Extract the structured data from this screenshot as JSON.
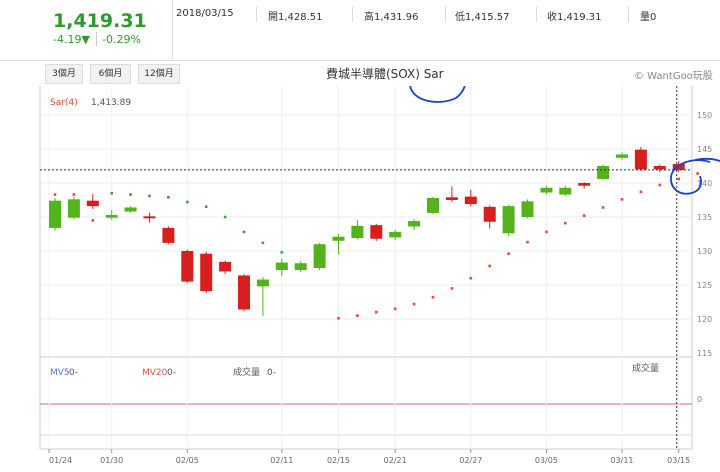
{
  "header": {
    "price": "1,419.31",
    "change": "-4.19▼",
    "change_pct": "-0.29%",
    "date": "2018/03/15",
    "open_label": "開",
    "open": "1,428.51",
    "high_label": "高",
    "high": "1,431.96",
    "low_label": "低",
    "low": "1,415.57",
    "close_label": "收",
    "close": "1,419.31",
    "volume_label": "量",
    "volume": "0"
  },
  "ranges": [
    "3個月",
    "6個月",
    "12個月"
  ],
  "chart_title": "費城半導體(SOX) Sar",
  "copyright": "© WantGoo玩股",
  "colors": {
    "up": "#d62020",
    "down": "#54b21c",
    "sar": "#e84a3a",
    "sar_down": "#3aa03a",
    "mv5": "#5b73d9",
    "mv20": "#d9534f",
    "zero_line": "#c96a8a"
  },
  "indicator": {
    "sar_label": "Sar(4)",
    "sar_value": "1,413.89",
    "mv5_label": "MV5",
    "mv5_value": "0-",
    "mv20_label": "MV20",
    "mv20_value": "0-",
    "vol_label": "成交量",
    "vol_value": "0-",
    "vol_axis_label": "成交量",
    "vol_zero": "0"
  },
  "chart_data": {
    "type": "candlestick",
    "title": "費城半導體(SOX) Sar",
    "y_ticks": [
      "150",
      "145",
      "140",
      "135",
      "130",
      "125",
      "120",
      "115"
    ],
    "y_unit_note": "labels truncated at right edge (e.g. 1400)",
    "ylim": [
      1150,
      1520
    ],
    "x_ticks": [
      "01/24",
      "01/30",
      "02/05",
      "02/11",
      "02/15",
      "02/21",
      "02/27",
      "03/05",
      "03/11",
      "03/15"
    ],
    "candles": [
      {
        "o": 1334,
        "c": 1374,
        "h": 1378,
        "l": 1330
      },
      {
        "o": 1349,
        "c": 1376,
        "h": 1380,
        "l": 1347
      },
      {
        "o": 1374,
        "c": 1366,
        "h": 1384,
        "l": 1362
      },
      {
        "o": 1349,
        "c": 1353,
        "h": 1360,
        "l": 1346
      },
      {
        "o": 1358,
        "c": 1364,
        "h": 1366,
        "l": 1356
      },
      {
        "o": 1351,
        "c": 1348,
        "h": 1356,
        "l": 1342
      },
      {
        "o": 1334,
        "c": 1312,
        "h": 1336,
        "l": 1310
      },
      {
        "o": 1300,
        "c": 1255,
        "h": 1302,
        "l": 1253
      },
      {
        "o": 1296,
        "c": 1241,
        "h": 1299,
        "l": 1238
      },
      {
        "o": 1284,
        "c": 1270,
        "h": 1286,
        "l": 1266
      },
      {
        "o": 1264,
        "c": 1214,
        "h": 1266,
        "l": 1211
      },
      {
        "o": 1248,
        "c": 1258,
        "h": 1262,
        "l": 1205
      },
      {
        "o": 1272,
        "c": 1283,
        "h": 1289,
        "l": 1263
      },
      {
        "o": 1272,
        "c": 1282,
        "h": 1285,
        "l": 1269
      },
      {
        "o": 1275,
        "c": 1310,
        "h": 1312,
        "l": 1272
      },
      {
        "o": 1315,
        "c": 1321,
        "h": 1325,
        "l": 1295
      },
      {
        "o": 1319,
        "c": 1337,
        "h": 1346,
        "l": 1317
      },
      {
        "o": 1338,
        "c": 1318,
        "h": 1340,
        "l": 1315
      },
      {
        "o": 1320,
        "c": 1328,
        "h": 1331,
        "l": 1316
      },
      {
        "o": 1336,
        "c": 1344,
        "h": 1347,
        "l": 1331
      },
      {
        "o": 1356,
        "c": 1378,
        "h": 1380,
        "l": 1354
      },
      {
        "o": 1379,
        "c": 1375,
        "h": 1395,
        "l": 1372
      },
      {
        "o": 1380,
        "c": 1369,
        "h": 1390,
        "l": 1366
      },
      {
        "o": 1365,
        "c": 1343,
        "h": 1367,
        "l": 1333
      },
      {
        "o": 1326,
        "c": 1366,
        "h": 1368,
        "l": 1322
      },
      {
        "o": 1350,
        "c": 1373,
        "h": 1376,
        "l": 1348
      },
      {
        "o": 1386,
        "c": 1393,
        "h": 1396,
        "l": 1383
      },
      {
        "o": 1383,
        "c": 1393,
        "h": 1396,
        "l": 1381
      },
      {
        "o": 1400,
        "c": 1396,
        "h": 1401,
        "l": 1392
      },
      {
        "o": 1406,
        "c": 1425,
        "h": 1427,
        "l": 1404
      },
      {
        "o": 1437,
        "c": 1442,
        "h": 1445,
        "l": 1434
      },
      {
        "o": 1449,
        "c": 1420,
        "h": 1453,
        "l": 1418
      },
      {
        "o": 1425,
        "c": 1420,
        "h": 1427,
        "l": 1416
      },
      {
        "o": 1428,
        "c": 1419,
        "h": 1432,
        "l": 1416
      }
    ],
    "sar": [
      {
        "i": 0,
        "v": 1383,
        "trend": "up"
      },
      {
        "i": 1,
        "v": 1383,
        "trend": "up"
      },
      {
        "i": 2,
        "v": 1345,
        "trend": "up"
      },
      {
        "i": 3,
        "v": 1385,
        "trend": "down"
      },
      {
        "i": 4,
        "v": 1383,
        "trend": "down"
      },
      {
        "i": 5,
        "v": 1381,
        "trend": "down"
      },
      {
        "i": 6,
        "v": 1379,
        "trend": "down"
      },
      {
        "i": 7,
        "v": 1372,
        "trend": "down"
      },
      {
        "i": 8,
        "v": 1365,
        "trend": "down"
      },
      {
        "i": 9,
        "v": 1350,
        "trend": "down"
      },
      {
        "i": 10,
        "v": 1328,
        "trend": "down"
      },
      {
        "i": 11,
        "v": 1312,
        "trend": "down"
      },
      {
        "i": 12,
        "v": 1298,
        "trend": "down"
      },
      {
        "i": 15,
        "v": 1201,
        "trend": "up"
      },
      {
        "i": 16,
        "v": 1205,
        "trend": "up"
      },
      {
        "i": 17,
        "v": 1210,
        "trend": "up"
      },
      {
        "i": 18,
        "v": 1215,
        "trend": "up"
      },
      {
        "i": 19,
        "v": 1222,
        "trend": "up"
      },
      {
        "i": 20,
        "v": 1232,
        "trend": "up"
      },
      {
        "i": 21,
        "v": 1245,
        "trend": "up"
      },
      {
        "i": 22,
        "v": 1260,
        "trend": "up"
      },
      {
        "i": 23,
        "v": 1278,
        "trend": "up"
      },
      {
        "i": 24,
        "v": 1296,
        "trend": "up"
      },
      {
        "i": 25,
        "v": 1313,
        "trend": "up"
      },
      {
        "i": 26,
        "v": 1328,
        "trend": "up"
      },
      {
        "i": 27,
        "v": 1341,
        "trend": "up"
      },
      {
        "i": 28,
        "v": 1352,
        "trend": "up"
      },
      {
        "i": 29,
        "v": 1364,
        "trend": "up"
      },
      {
        "i": 30,
        "v": 1376,
        "trend": "up"
      },
      {
        "i": 31,
        "v": 1387,
        "trend": "up"
      },
      {
        "i": 32,
        "v": 1397,
        "trend": "up"
      },
      {
        "i": 33,
        "v": 1406,
        "trend": "up"
      },
      {
        "i": 34,
        "v": 1413.89,
        "trend": "up"
      }
    ],
    "current_level": 1419.31
  }
}
